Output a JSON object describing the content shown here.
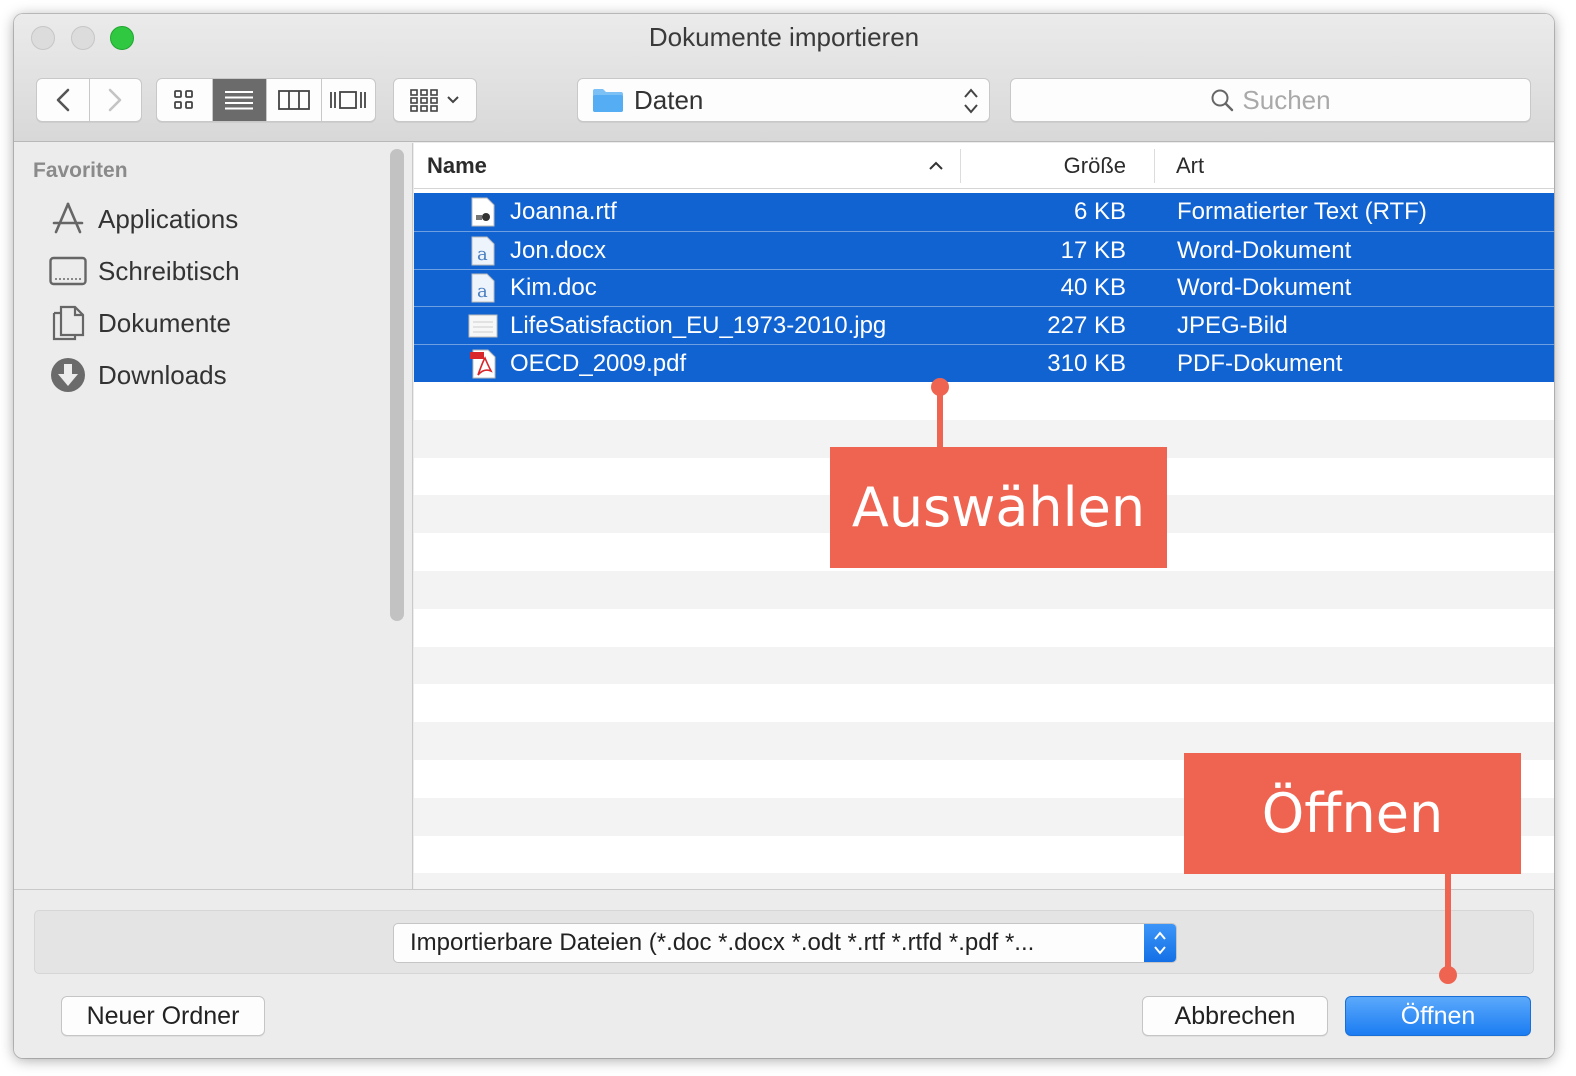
{
  "window": {
    "title": "Dokumente importieren"
  },
  "toolbar": {
    "back_icon": "chevron-left-icon",
    "forward_icon": "chevron-right-icon",
    "view_modes": [
      "icon-view",
      "list-view",
      "column-view",
      "coverflow-view"
    ],
    "active_view": "list-view",
    "location": "Daten",
    "search_placeholder": "Suchen"
  },
  "sidebar": {
    "heading": "Favoriten",
    "items": [
      {
        "label": "Applications",
        "icon": "applications-icon"
      },
      {
        "label": "Schreibtisch",
        "icon": "desktop-icon"
      },
      {
        "label": "Dokumente",
        "icon": "documents-icon"
      },
      {
        "label": "Downloads",
        "icon": "downloads-icon"
      }
    ]
  },
  "filelist": {
    "columns": {
      "name": "Name",
      "size": "Größe",
      "kind": "Art"
    },
    "sort_column": "Name",
    "rows": [
      {
        "name": "Joanna.rtf",
        "size": "6 KB",
        "kind": "Formatierter Text (RTF)",
        "icon": "rtf-file-icon",
        "selected": true
      },
      {
        "name": "Jon.docx",
        "size": "17 KB",
        "kind": "Word-Dokument",
        "icon": "word-file-icon",
        "selected": true
      },
      {
        "name": "Kim.doc",
        "size": "40 KB",
        "kind": "Word-Dokument",
        "icon": "word-file-icon",
        "selected": true
      },
      {
        "name": "LifeSatisfaction_EU_1973-2010.jpg",
        "size": "227 KB",
        "kind": "JPEG-Bild",
        "icon": "jpeg-file-icon",
        "selected": true
      },
      {
        "name": "OECD_2009.pdf",
        "size": "310 KB",
        "kind": "PDF-Dokument",
        "icon": "pdf-file-icon",
        "selected": true
      }
    ]
  },
  "bottom": {
    "filter": "Importierbare Dateien (*.doc *.docx *.odt *.rtf *.rtfd *.pdf *...",
    "new_folder": "Neuer Ordner",
    "cancel": "Abbrechen",
    "open": "Öffnen"
  },
  "annotations": {
    "select": "Auswählen",
    "open": "Öffnen",
    "color": "#ef6451"
  },
  "colors": {
    "selection": "#1163d2",
    "primary_button": "#1b7cf2",
    "zoom_light": "#2fc840"
  }
}
